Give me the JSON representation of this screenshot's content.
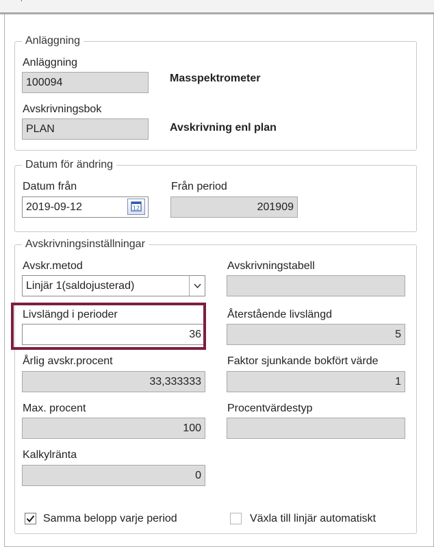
{
  "topbar": {
    "partial_glyph": "’"
  },
  "anlaggning_group": {
    "legend": "Anläggning",
    "anlaggning_label": "Anläggning",
    "anlaggning_value": "100094",
    "anlaggning_name": "Masspektrometer",
    "bok_label": "Avskrivningsbok",
    "bok_value": "PLAN",
    "bok_name": "Avskrivning enl plan"
  },
  "datum_group": {
    "legend": "Datum för ändring",
    "datum_fran_label": "Datum från",
    "datum_fran_value": "2019-09-12",
    "calendar_icon": "calendar-icon",
    "fran_period_label": "Från period",
    "fran_period_value": "201909"
  },
  "installningar_group": {
    "legend": "Avskrivningsinställningar",
    "metod_label": "Avskr.metod",
    "metod_value": "Linjär 1(saldojusterad)",
    "tabell_label": "Avskrivningstabell",
    "tabell_value": "",
    "livslangd_label": "Livslängd i perioder",
    "livslangd_value": "36",
    "aterstaende_label": "Återstående livslängd",
    "aterstaende_value": "5",
    "arlig_label": "Årlig avskr.procent",
    "arlig_value": "33,333333",
    "faktor_label": "Faktor sjunkande bokfört värde",
    "faktor_value": "1",
    "max_label": "Max. procent",
    "max_value": "100",
    "procenttyp_label": "Procentvärdestyp",
    "procenttyp_value": "",
    "kalkyl_label": "Kalkylränta",
    "kalkyl_value": "0",
    "samma_label": "Samma belopp varje period",
    "samma_checked": true,
    "vaxla_label": "Växla till linjär automatiskt",
    "vaxla_checked": false
  },
  "colors": {
    "highlight": "#7e1f3d",
    "readonly_field": "#dcdcdc"
  }
}
